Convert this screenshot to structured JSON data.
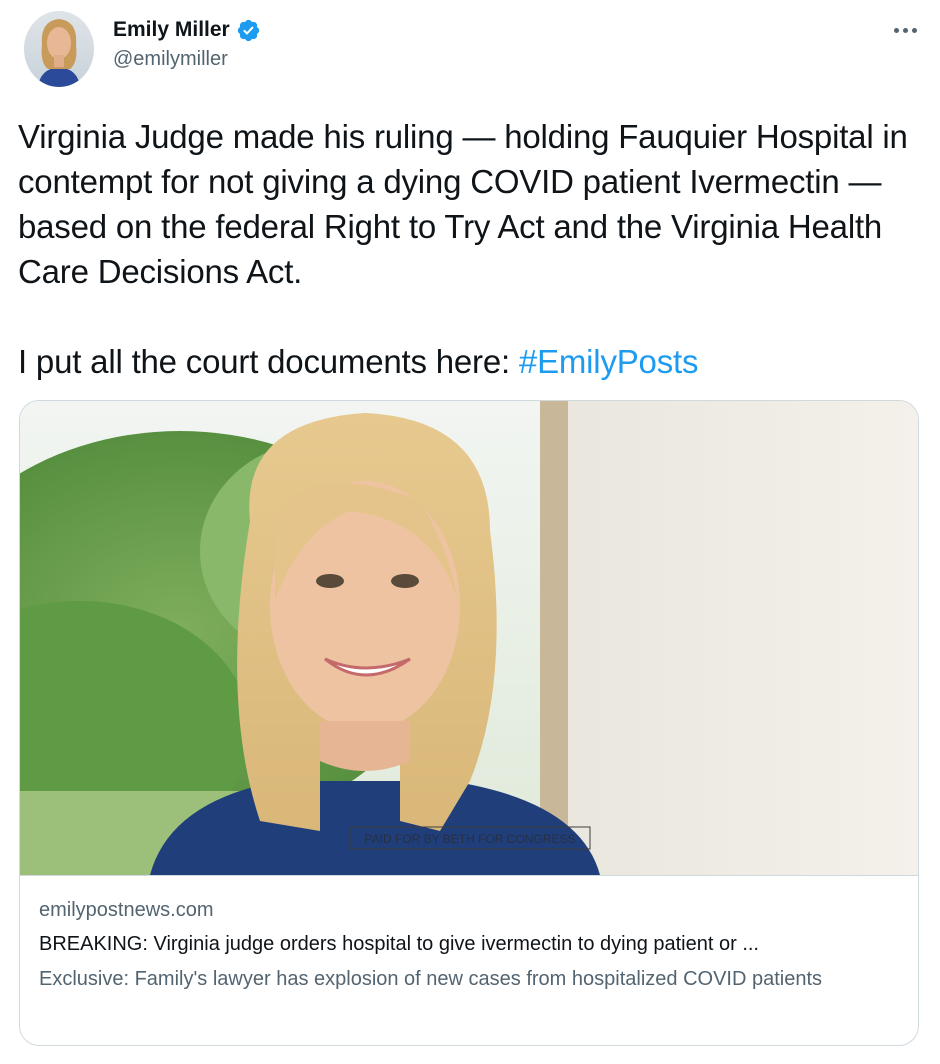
{
  "author": {
    "name": "Emily Miller",
    "handle": "@emilymiller"
  },
  "tweet": {
    "paragraph1": "Virginia Judge made his ruling — holding Fauquier Hospital in contempt for not giving a dying COVID patient Ivermectin — based on the federal Right to Try Act and the Virginia Health Care Decisions Act.",
    "paragraph2_text": "I put all the court documents here: ",
    "hashtag": "#EmilyPosts"
  },
  "card": {
    "image_watermark": "PAID FOR BY BETH FOR CONGRESS",
    "domain": "emilypostnews.com",
    "title": "BREAKING: Virginia judge orders hospital to give ivermectin to dying patient or ...",
    "description": "Exclusive: Family's lawyer has explosion of new cases from hospitalized COVID patients"
  },
  "colors": {
    "accent": "#1d9bf0",
    "text_primary": "#0f1419",
    "text_secondary": "#536471",
    "border": "#cfd9de"
  },
  "icons": [
    "verified-badge-icon",
    "more-options-icon"
  ]
}
